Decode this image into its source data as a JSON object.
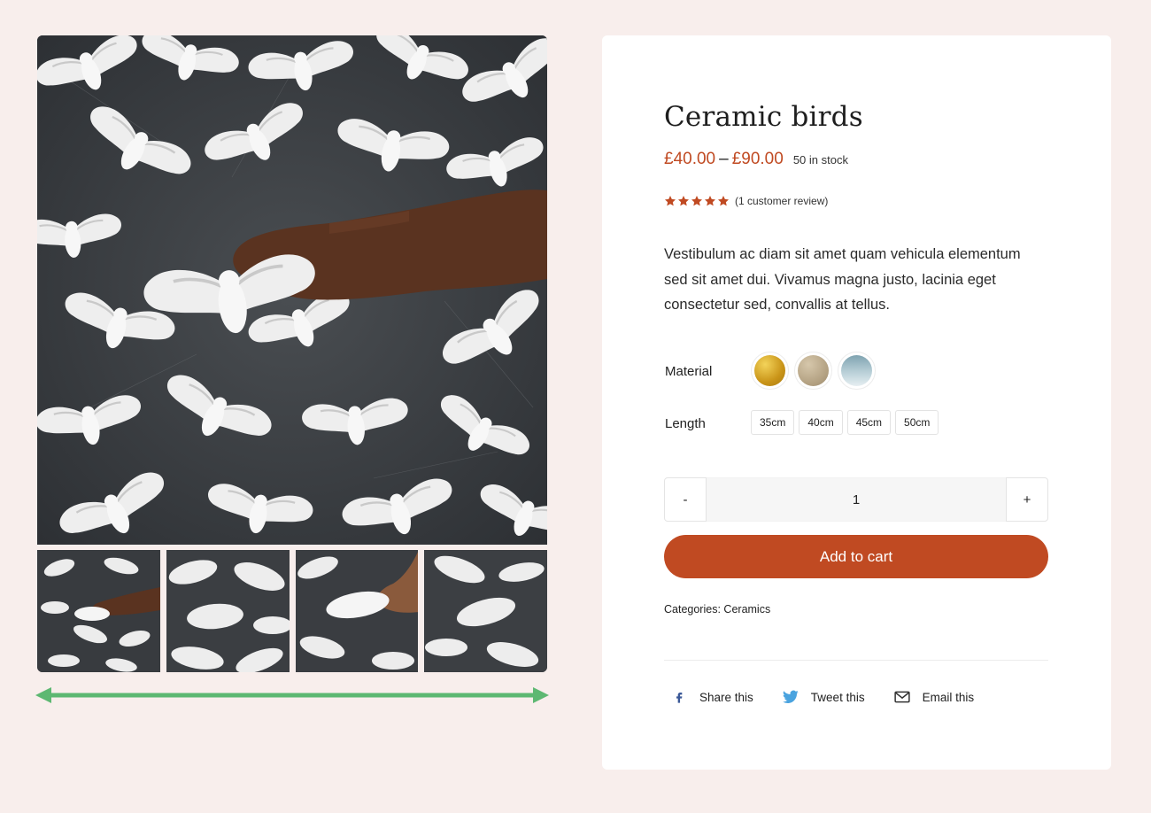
{
  "product": {
    "title": "Ceramic birds",
    "price_min": "£40.00",
    "price_separator": "–",
    "price_max": "£90.00",
    "stock": "50 in stock",
    "rating": 5,
    "review_link": "(1 customer review)",
    "description": "Vestibulum ac diam sit amet quam vehicula elementum sed sit amet dui. Vivamus magna justo, lacinia eget consectetur sed, convallis at tellus."
  },
  "material": {
    "label": "Material",
    "swatches": [
      {
        "name": "gold",
        "color": "#d4a32a"
      },
      {
        "name": "beige",
        "color": "#bba98a"
      },
      {
        "name": "blue",
        "color": "#9fbcc6"
      }
    ]
  },
  "length": {
    "label": "Length",
    "options": [
      "35cm",
      "40cm",
      "45cm",
      "50cm"
    ]
  },
  "quantity": {
    "minus": "-",
    "value": "1",
    "plus": "+"
  },
  "cart": {
    "button_label": "Add to cart"
  },
  "categories": {
    "label": "Categories:",
    "value": "Ceramics"
  },
  "share": {
    "facebook": "Share this",
    "twitter": "Tweet this",
    "email": "Email this"
  },
  "colors": {
    "accent": "#c04a22",
    "page_background": "#f8eeec",
    "panel_background": "#ffffff",
    "scroll_indicator": "#5db872",
    "facebook": "#3b5998",
    "twitter": "#4aa3df"
  },
  "gallery": {
    "thumbnail_count": 4
  }
}
